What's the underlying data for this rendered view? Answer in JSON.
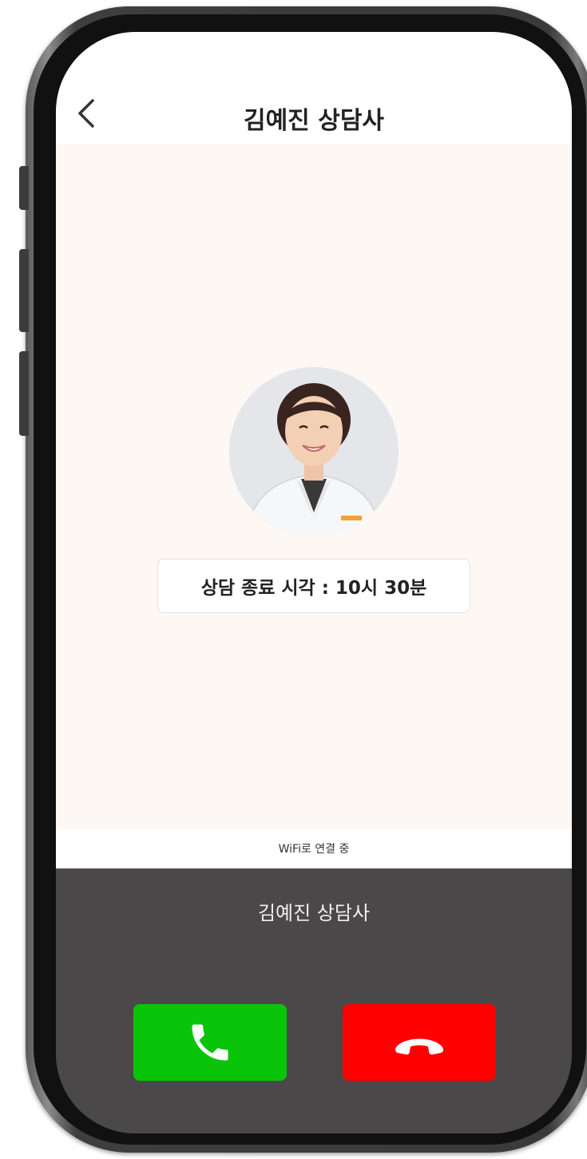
{
  "header": {
    "title": "김예진 상담사",
    "back_icon": "chevron-left-icon"
  },
  "video": {
    "avatar": "counselor-avatar",
    "end_time_label": "상담 종료 시각 :  10시 30분"
  },
  "connection": {
    "status": "WiFi로 연결 중"
  },
  "call": {
    "caller_name": "김예진 상담사",
    "accept_icon": "phone-icon",
    "decline_icon": "phone-hangup-icon"
  },
  "colors": {
    "accept": "#0ac40a",
    "decline": "#ff0000",
    "panel": "#4a4848",
    "video_bg": "#fdf8f4"
  }
}
